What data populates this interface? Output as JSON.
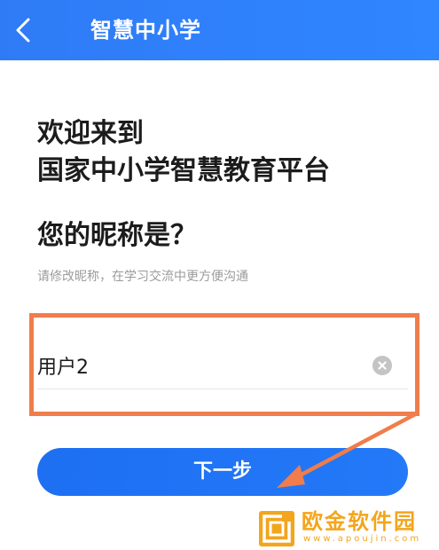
{
  "header": {
    "title": "智慧中小学",
    "back_icon": "chevron-left-icon",
    "background_color": "#2f7bf6"
  },
  "welcome": {
    "line1": "欢迎来到",
    "line2": "国家中小学智慧教育平台"
  },
  "question": "您的昵称是？",
  "hint": "请修改昵称，在学习交流中更方便沟通",
  "nickname_input": {
    "value": "用户2",
    "clear_icon": "clear-circle-icon"
  },
  "next_button": {
    "label": "下一步",
    "color": "#1e6ff2"
  },
  "annotation": {
    "highlight_color": "#f07d4b",
    "arrow_icon": "arrow-icon"
  },
  "watermark": {
    "name": "欧金软件园",
    "url": "www.apoujin.com",
    "color": "#f3a51c"
  }
}
